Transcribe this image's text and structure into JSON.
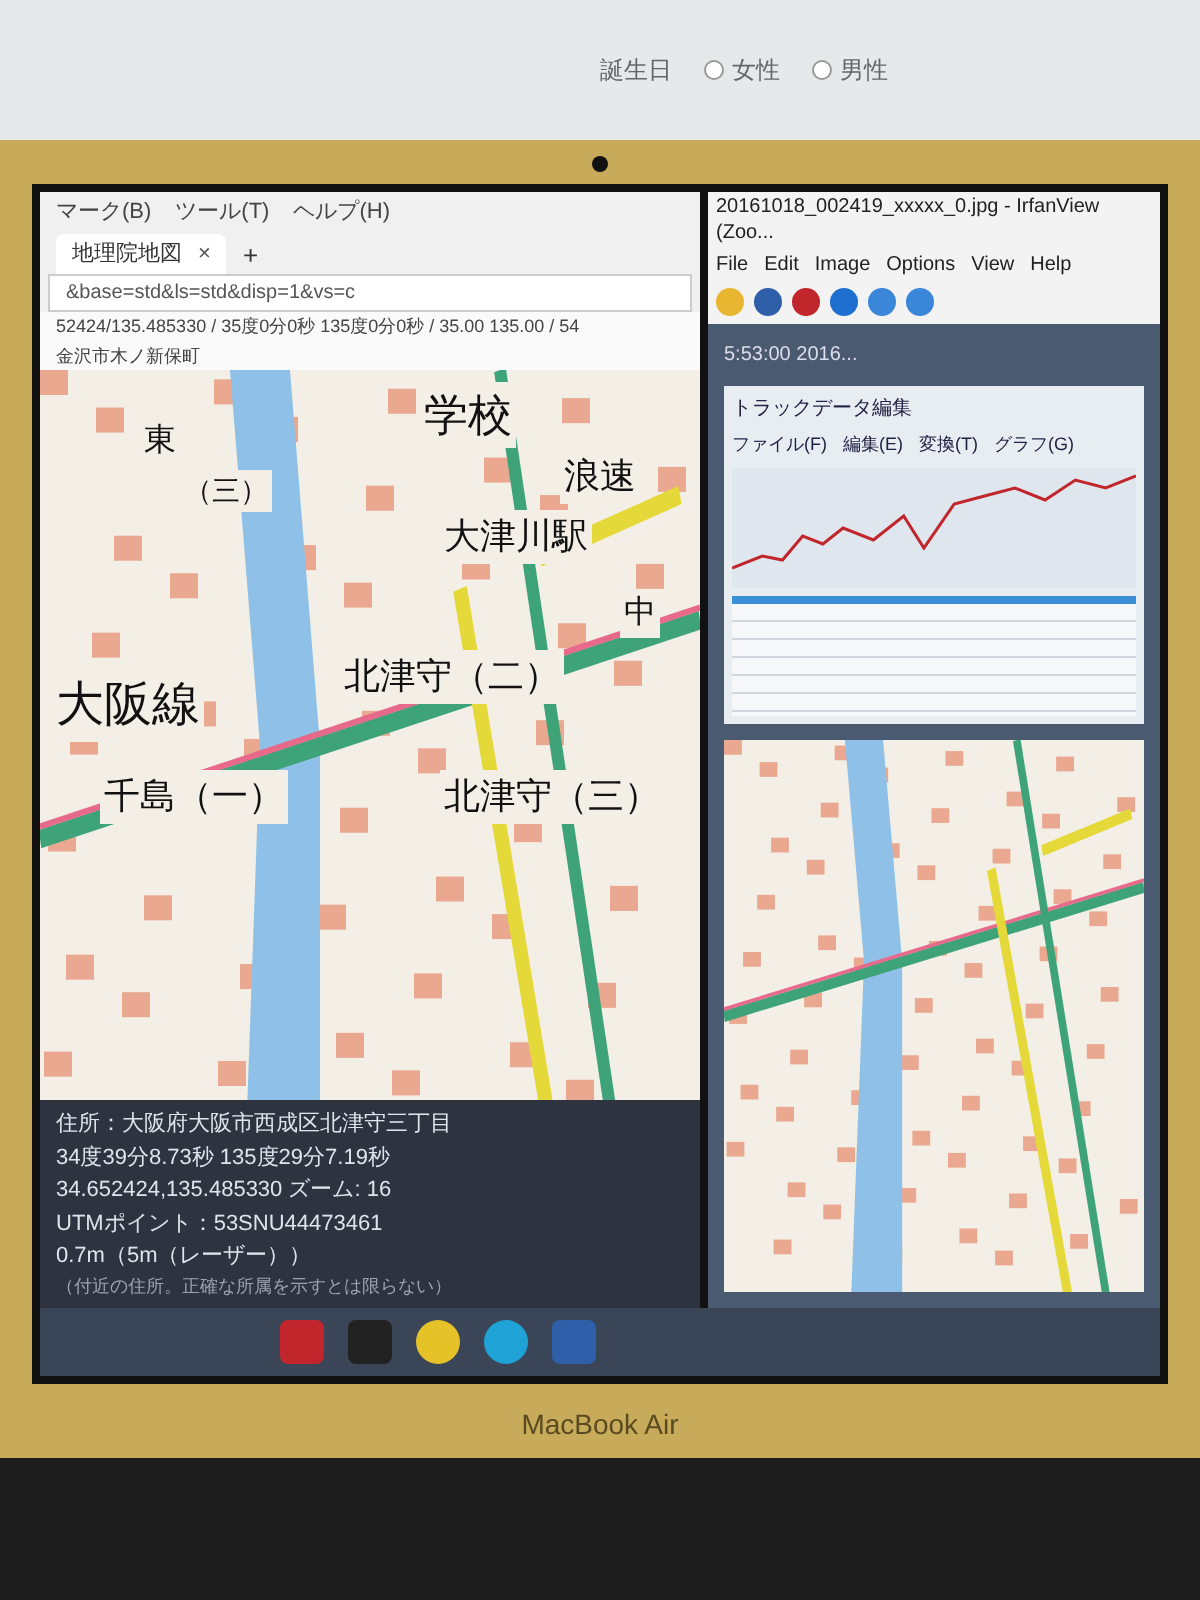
{
  "background_form": {
    "label": "誕生日",
    "options": [
      {
        "label": "女性",
        "selected": false
      },
      {
        "label": "男性",
        "selected": false
      }
    ]
  },
  "browser": {
    "menu": [
      "マーク(B)",
      "ツール(T)",
      "ヘルプ(H)"
    ],
    "tab": {
      "title": "地理院地図",
      "close": "×"
    },
    "new_tab": "+",
    "url": "&base=std&ls=std&disp=1&vs=c",
    "coords": "52424/135.485330 / 35度0分0秒 135度0分0秒 / 35.00 135.00 / 54",
    "place": "金沢市木ノ新保町"
  },
  "map": {
    "labels": [
      "学校",
      "浪速",
      "大津川駅",
      "東",
      "（三）",
      "大阪線",
      "北津守（二）",
      "中",
      "千島（一）",
      "北津守（三）"
    ]
  },
  "status_panel": {
    "lines": [
      "住所：大阪府大阪市西成区北津守三丁目",
      "34度39分8.73秒 135度29分7.19秒",
      "34.652424,135.485330 ズーム: 16",
      "UTMポイント：53SNU44473461",
      "0.7m（5m（レーザー））"
    ],
    "note": "（付近の住所。正確な所属を示すとは限らない）"
  },
  "irfanview": {
    "title": "20161018_002419_xxxxx_0.jpg - IrfanView (Zoo...",
    "menu": [
      "File",
      "Edit",
      "Image",
      "Options",
      "View",
      "Help"
    ],
    "image": {
      "time": "5:53:00 2016...",
      "title": "トラックデータ編集",
      "menu": [
        "ファイル(F)",
        "編集(E)",
        "変換(T)",
        "グラフ(G)"
      ]
    }
  },
  "laptop": {
    "brand": "MacBook Air"
  }
}
